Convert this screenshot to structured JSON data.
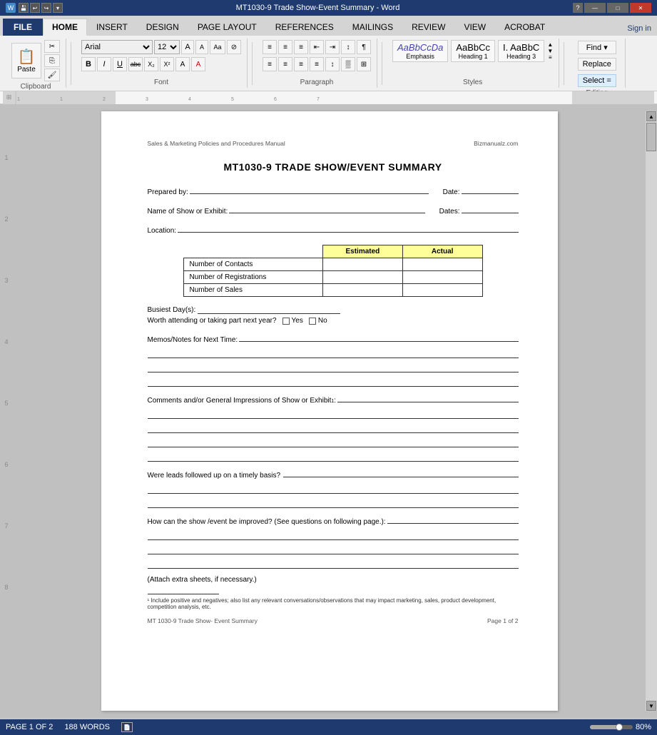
{
  "titlebar": {
    "title": "MT1030-9 Trade Show-Event Summary - Word",
    "controls": [
      "—",
      "□",
      "✕"
    ]
  },
  "ribbon": {
    "tabs": [
      "FILE",
      "HOME",
      "INSERT",
      "DESIGN",
      "PAGE LAYOUT",
      "REFERENCES",
      "MAILINGS",
      "REVIEW",
      "VIEW",
      "ACROBAT"
    ],
    "active_tab": "HOME",
    "font": {
      "name": "Arial",
      "size": "12",
      "grow_label": "A",
      "shrink_label": "A",
      "case_label": "Aa",
      "bold": "B",
      "italic": "I",
      "underline": "U",
      "strikethrough": "abc",
      "subscript": "X₂",
      "superscript": "X²",
      "highlight": "A",
      "font_color": "A"
    },
    "paragraph": {
      "bullets_label": "≡",
      "numbering_label": "≡",
      "multilevel_label": "≡",
      "decrease_indent": "⇤",
      "increase_indent": "⇥",
      "sort_label": "↕",
      "show_marks": "¶",
      "align_left": "≡",
      "align_center": "≡",
      "align_right": "≡",
      "justify": "≡",
      "line_spacing": "≡",
      "shading": "▓",
      "borders": "⊞"
    },
    "styles": {
      "items": [
        {
          "label": "Emphasis",
          "style": "italic"
        },
        {
          "label": "Heading 1",
          "style": "normal"
        },
        {
          "label": "Heading 3",
          "style": "normal"
        }
      ]
    },
    "editing": {
      "find": "Find ▾",
      "replace": "Replace",
      "select": "Select ="
    },
    "sign_in": "Sign in"
  },
  "document": {
    "header_left": "Sales & Marketing Policies and Procedures Manual",
    "header_right": "Bizmanualz.com",
    "title": "MT1030-9 TRADE SHOW/EVENT SUMMARY",
    "prepared_by_label": "Prepared by:",
    "date_label": "Date:",
    "name_of_show_label": "Name of Show or Exhibit:",
    "dates_label": "Dates:",
    "location_label": "Location:",
    "table": {
      "col1_header": "Estimated",
      "col2_header": "Actual",
      "rows": [
        {
          "label": "Number of Contacts"
        },
        {
          "label": "Number of Registrations"
        },
        {
          "label": "Number of Sales"
        }
      ]
    },
    "busiest_days_label": "Busiest Day(s):",
    "attend_question": "Worth attending or taking part next year?",
    "yes_label": "Yes",
    "no_label": "No",
    "memos_label": "Memos/Notes for Next Time:",
    "comments_label": "Comments and/or General Impressions of Show or Exhibit",
    "footnote_marker": "1",
    "leads_label": "Were leads followed up on a timely basis?",
    "improve_label": "How can the show /event be improved? (See questions on following page.):",
    "attach_note": "(Attach extra sheets, if necessary.)",
    "footnote": "¹ Include positive and negatives; also list any relevant conversations/observations that may impact marketing, sales, product development, competition analysis, etc.",
    "footer_left": "MT 1030-9 Trade Show- Event Summary",
    "footer_right": "Page 1 of 2"
  },
  "statusbar": {
    "page_info": "PAGE 1 OF 2",
    "word_count": "188 WORDS",
    "zoom": "80%"
  }
}
